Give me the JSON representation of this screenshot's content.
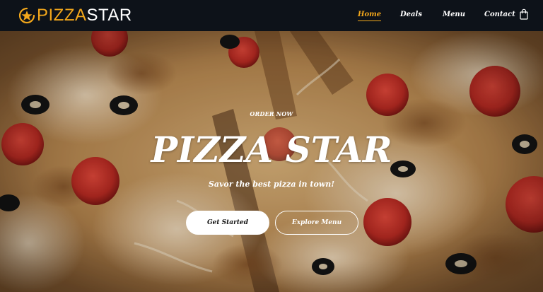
{
  "brand": {
    "part1": "PIZZA",
    "part2": "STAR"
  },
  "nav": {
    "items": [
      {
        "label": "Home"
      },
      {
        "label": "Deals"
      },
      {
        "label": "Menu"
      },
      {
        "label": "Contact"
      }
    ]
  },
  "hero": {
    "eyebrow": "ORDER NOW",
    "title": "PIZZA STAR",
    "subtitle": "Savor the best pizza in town!",
    "primary_button": "Get Started",
    "secondary_button": "Explore Menu"
  },
  "icons": {
    "logo": "star-icon",
    "cart": "shopping-bag-icon"
  },
  "colors": {
    "accent": "#f2a71b",
    "header_bg": "#0d1219",
    "text": "#ffffff"
  }
}
